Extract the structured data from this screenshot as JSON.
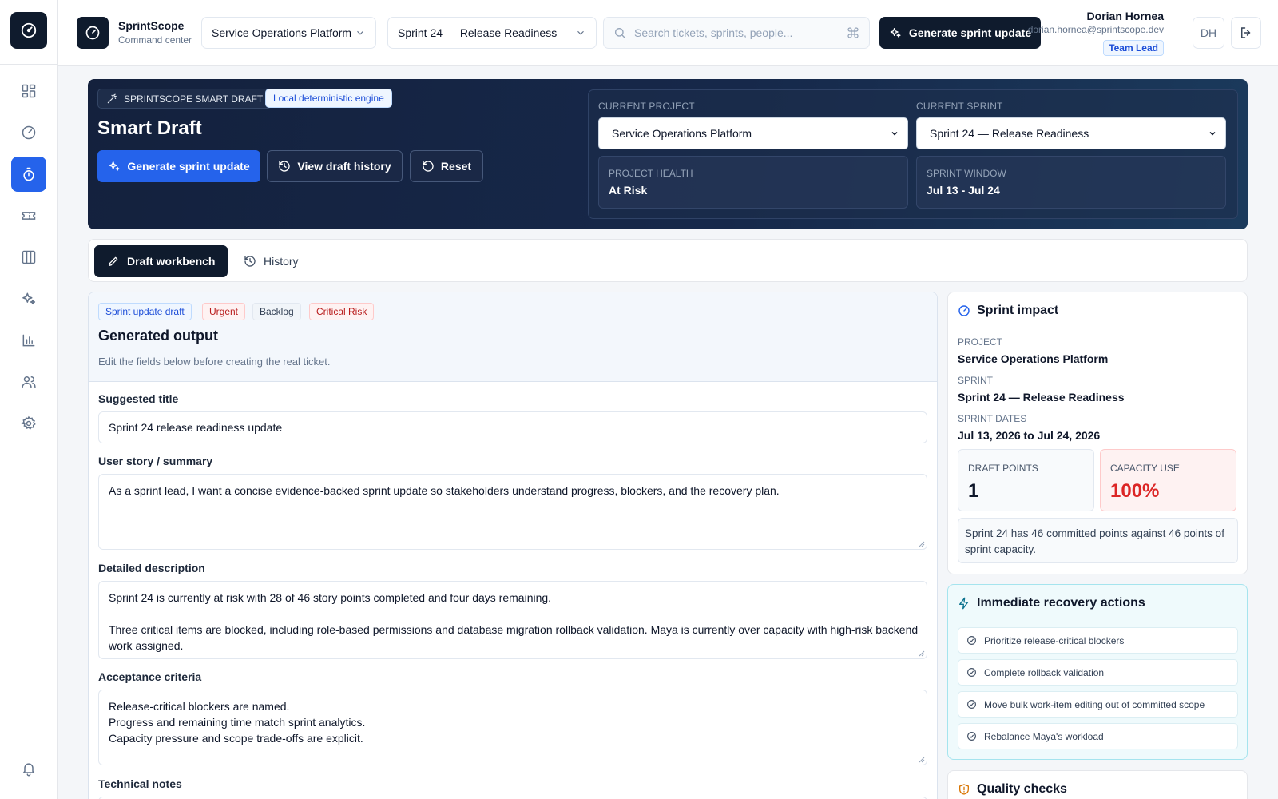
{
  "app": {
    "name": "SprintScope",
    "subtitle": "Command center"
  },
  "topbar": {
    "project_select": "Service Operations Platform",
    "sprint_select": "Sprint 24 — Release Readiness",
    "search_placeholder": "Search tickets, sprints, people...",
    "generate_label": "Generate sprint update",
    "user": {
      "name": "Dorian Hornea",
      "email": "dorian.hornea@sprintscope.dev",
      "role": "Team Lead",
      "initials": "DH"
    }
  },
  "sidebar": {
    "items": [
      {
        "icon": "dashboard-icon",
        "active": false
      },
      {
        "icon": "gauge-icon",
        "active": false
      },
      {
        "icon": "stopwatch-icon",
        "active": true
      },
      {
        "icon": "ticket-icon",
        "active": false
      },
      {
        "icon": "board-columns-icon",
        "active": false
      },
      {
        "icon": "sparkles-icon",
        "active": false
      },
      {
        "icon": "bar-chart-icon",
        "active": false
      },
      {
        "icon": "users-icon",
        "active": false
      },
      {
        "icon": "settings-icon",
        "active": false
      },
      {
        "icon": "bell-icon",
        "active": false
      }
    ]
  },
  "hero": {
    "badge": "SPRINTSCOPE SMART DRAFT",
    "engine_badge": "Local deterministic engine",
    "title": "Smart Draft",
    "btn_generate": "Generate sprint update",
    "btn_history": "View draft history",
    "btn_reset": "Reset",
    "current_project_label": "CURRENT PROJECT",
    "current_project": "Service Operations Platform",
    "current_sprint_label": "CURRENT SPRINT",
    "current_sprint": "Sprint 24 — Release Readiness",
    "health_label": "PROJECT HEALTH",
    "health_value": "At Risk",
    "window_label": "SPRINT WINDOW",
    "window_value": "Jul 13 - Jul 24"
  },
  "tabs": {
    "workbench": "Draft workbench",
    "history": "History"
  },
  "draft": {
    "chips": [
      "Sprint update draft",
      "Urgent",
      "Backlog",
      "Critical Risk"
    ],
    "title": "Generated output",
    "subtitle": "Edit the fields below before creating the real ticket.",
    "suggested_title_label": "Suggested title",
    "suggested_title": "Sprint 24 release readiness update",
    "summary_label": "User story / summary",
    "summary": "As a sprint lead, I want a concise evidence-backed sprint update so stakeholders understand progress, blockers, and the recovery plan.",
    "description_label": "Detailed description",
    "description_1": "Sprint 24 is currently at risk with 28 of 46 story points completed and four days remaining.",
    "description_2": "Three critical items are blocked, including role-based permissions and database migration rollback validation. Maya is currently over capacity with high-risk backend",
    "description_3": "work assigned.",
    "acceptance_label": "Acceptance criteria",
    "acceptance_1": "Release-critical blockers are named.",
    "acceptance_2": "Progress and remaining time match sprint analytics.",
    "acceptance_3": "Capacity pressure and scope trade-offs are explicit.",
    "tech_label": "Technical notes"
  },
  "impact": {
    "title": "Sprint impact",
    "project_label": "PROJECT",
    "project": "Service Operations Platform",
    "sprint_label": "SPRINT",
    "sprint": "Sprint 24 — Release Readiness",
    "dates_label": "SPRINT DATES",
    "dates": "Jul 13, 2026 to Jul 24, 2026",
    "draft_points_label": "DRAFT POINTS",
    "draft_points": "1",
    "capacity_label": "CAPACITY USE",
    "capacity": "100%",
    "note": "Sprint 24 has 46 committed points against 46 points of sprint capacity."
  },
  "recovery": {
    "title": "Immediate recovery actions",
    "actions": [
      "Prioritize release-critical blockers",
      "Complete rollback validation",
      "Move bulk work-item editing out of committed scope",
      "Rebalance Maya's workload"
    ]
  },
  "quality": {
    "title": "Quality checks"
  },
  "colors": {
    "navy": "#0f1b2d",
    "primary": "#2563eb",
    "danger": "#dc2626",
    "teal_panel": "#effafc"
  }
}
